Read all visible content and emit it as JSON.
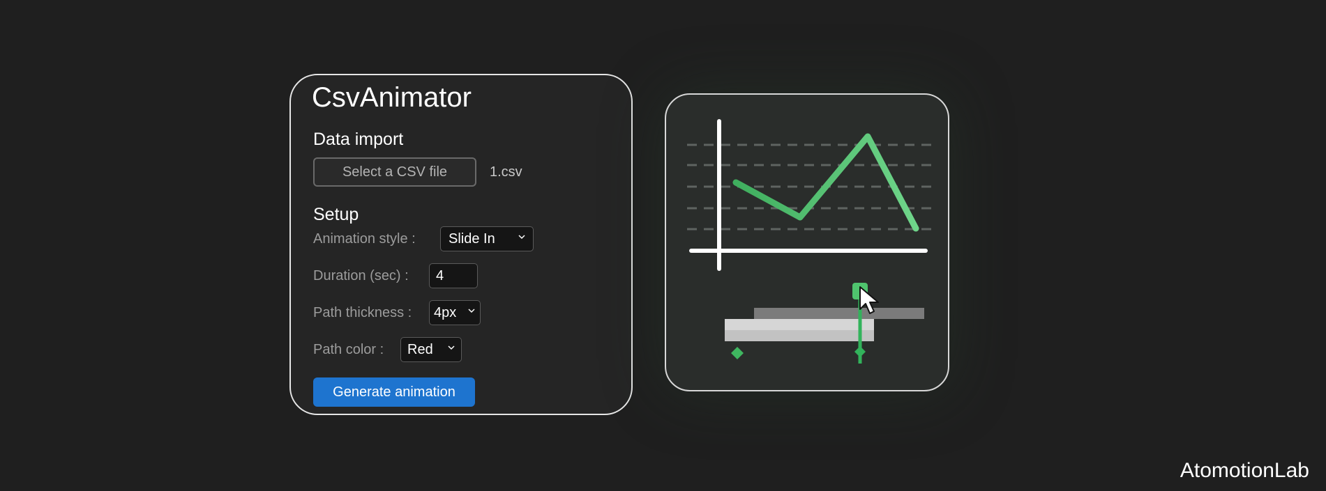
{
  "app": {
    "title": "CsvAnimator",
    "brand": "AtomotionLab"
  },
  "data_import": {
    "heading": "Data import",
    "select_file_label": "Select a CSV file",
    "file_name": "1.csv"
  },
  "setup": {
    "heading": "Setup",
    "animation_style": {
      "label": "Animation style :",
      "value": "Slide In"
    },
    "duration": {
      "label": "Duration (sec) :",
      "value": "4"
    },
    "path_thickness": {
      "label": "Path thickness :",
      "value": "4px"
    },
    "path_color": {
      "label": "Path color :",
      "value": "Red"
    }
  },
  "actions": {
    "generate_label": "Generate animation"
  },
  "preview": {
    "line_color": "#4fbf6b",
    "playhead_color": "#32b35b",
    "icons": [
      "cursor-icon",
      "playhead-handle-icon",
      "keyframe-diamond-icon"
    ]
  }
}
